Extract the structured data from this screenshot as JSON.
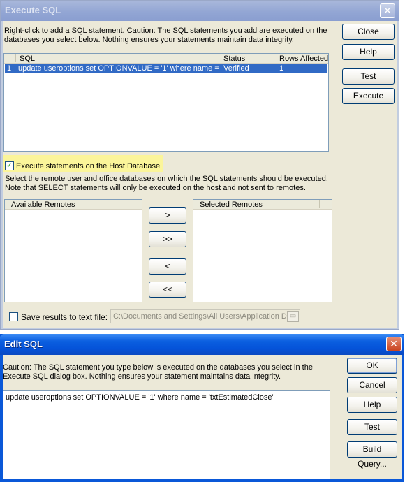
{
  "execute_sql": {
    "title": "Execute SQL",
    "close_glyph": "✕",
    "intro": [
      "Right-click to add a SQL statement. Caution: The SQL statements you add are executed on the",
      "databases you select below. Nothing ensures your statements maintain data integrity."
    ],
    "columns": {
      "sql": "SQL",
      "status": "Status",
      "rows": "Rows Affected"
    },
    "statement": {
      "index": "1",
      "sql": "update useroptions set OPTIONVALUE = '1' where name = ...",
      "status": "Verified",
      "rows": "1"
    },
    "host_checkbox_label": "Execute statements on the Host Database",
    "host_checked": true,
    "remotes_info": [
      "Select the remote user and office databases on which the SQL statements should be executed.",
      "Note that SELECT statements will only be executed on the host and not sent to remotes."
    ],
    "available_remotes_header": "Available Remotes",
    "selected_remotes_header": "Selected Remotes",
    "move_buttons": {
      "add": ">",
      "add_all": ">>",
      "remove": "<",
      "remove_all": "<<"
    },
    "save_results_label": "Save results to text file:",
    "save_results_checked": false,
    "save_path": "C:\\Documents and Settings\\All Users\\Application Da",
    "buttons": {
      "close": "Close",
      "help": "Help",
      "test": "Test",
      "execute": "Execute"
    }
  },
  "edit_sql": {
    "title": "Edit SQL",
    "close_glyph": "✕",
    "caution": [
      "Caution: The SQL statement you type below is executed on the databases you select in the",
      "Execute SQL dialog box. Nothing ensures your statement maintains data integrity."
    ],
    "statement": "update useroptions set OPTIONVALUE = '1' where name = 'txtEstimatedClose'",
    "buttons": {
      "ok": "OK",
      "cancel": "Cancel",
      "help": "Help",
      "test": "Test",
      "build_query": "Build Query..."
    }
  }
}
